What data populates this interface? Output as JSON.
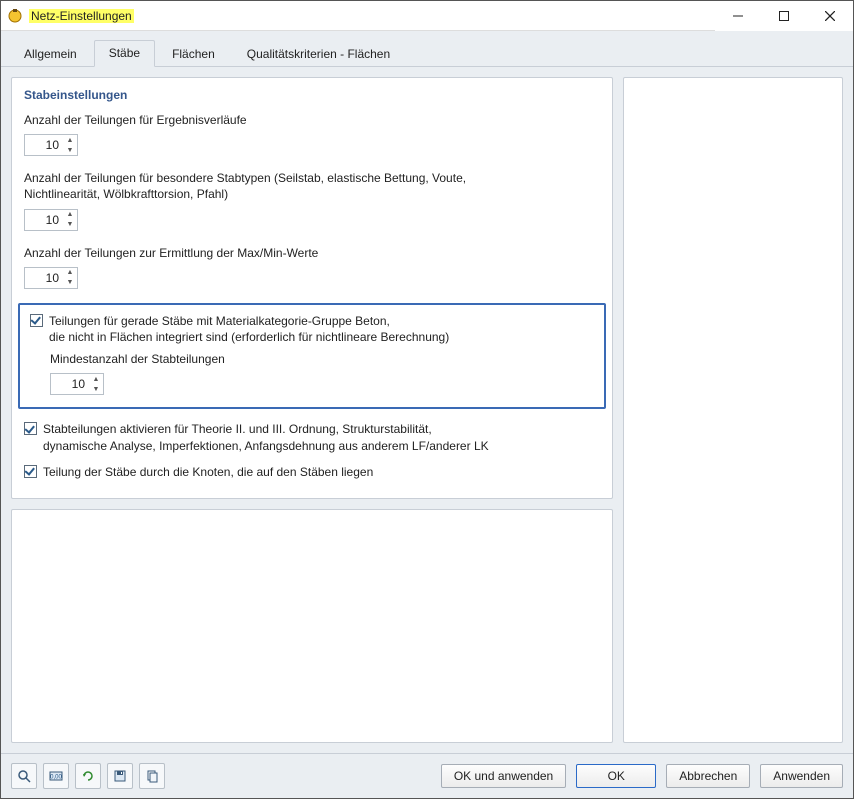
{
  "window": {
    "title": "Netz-Einstellungen"
  },
  "tabs": {
    "general": "Allgemein",
    "members": "Stäbe",
    "surfaces": "Flächen",
    "quality": "Qualitätskriterien - Flächen"
  },
  "section": {
    "title": "Stabeinstellungen",
    "div_results": {
      "label": "Anzahl der Teilungen für Ergebnisverläufe",
      "value": "10"
    },
    "div_special": {
      "label": "Anzahl der Teilungen für besondere Stabtypen (Seilstab, elastische Bettung, Voute, Nichtlinearität, Wölbkrafttorsion, Pfahl)",
      "value": "10"
    },
    "div_maxmin": {
      "label": "Anzahl der Teilungen zur Ermittlung der Max/Min-Werte",
      "value": "10"
    },
    "beton_check": {
      "line1": "Teilungen für gerade Stäbe mit Materialkategorie-Gruppe Beton,",
      "line2": "die nicht in Flächen integriert sind (erforderlich für nichtlineare Berechnung)",
      "sub_label": "Mindestanzahl der Stabteilungen",
      "value": "10",
      "checked": true
    },
    "theory_check": {
      "line1": "Stabteilungen aktivieren für Theorie II. und III. Ordnung, Strukturstabilität,",
      "line2": "dynamische Analyse, Imperfektionen, Anfangsdehnung aus anderem LF/anderer LK",
      "checked": true
    },
    "nodes_check": {
      "label": "Teilung der Stäbe durch die Knoten, die auf den Stäben liegen",
      "checked": true
    }
  },
  "footer": {
    "ok_apply": "OK und anwenden",
    "ok": "OK",
    "cancel": "Abbrechen",
    "apply": "Anwenden"
  }
}
